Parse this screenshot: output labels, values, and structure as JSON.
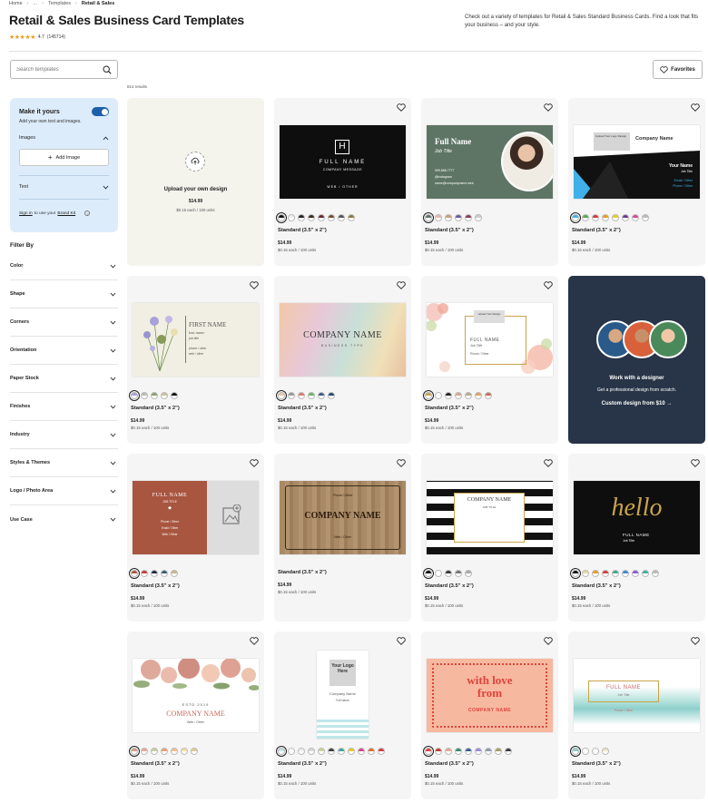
{
  "breadcrumb": [
    "Home",
    "...",
    "Templates",
    "Retail & Sales"
  ],
  "title": "Retail & Sales Business Card Templates",
  "rating": {
    "stars": "★★★★★",
    "value": "4.7",
    "count": "(145714)"
  },
  "description": "Check out a variety of templates for Retail & Sales Standard Business Cards. Find a look that fits your business – and your style.",
  "search": {
    "placeholder": "Search templates"
  },
  "favorites_label": "Favorites",
  "results_count": "814 results",
  "make_it_yours": {
    "title": "Make it yours",
    "subtitle": "Add your own text and images.",
    "images_label": "Images",
    "add_image": "Add Image",
    "text_label": "Text",
    "sign_in": "Sign in",
    "sign_mid": "to use your",
    "brand_kit": "Brand Kit"
  },
  "filter_by": "Filter By",
  "filters": [
    "Color",
    "Shape",
    "Corners",
    "Orientation",
    "Paper Stock",
    "Finishes",
    "Industry",
    "Styles & Themes",
    "Logo / Photo Area",
    "Use Case"
  ],
  "upload": {
    "title": "Upload your own design",
    "price": "$14.99",
    "units": "$0.15 each / 100 units"
  },
  "designer": {
    "title": "Work with a designer",
    "sub": "Get a professional design from scratch.",
    "link": "Custom design from $10 →"
  },
  "product": {
    "name": "Standard (3.5\" x 2\")",
    "price": "$14.99",
    "units": "$0.15 each / 100 units"
  },
  "cards": {
    "c1": {
      "name": "FULL NAME",
      "msg": "COMPANY MESSAGE",
      "web": "WEB / OTHER"
    },
    "c2": {
      "name": "Full Name",
      "job": "Job Title",
      "p1": "999.888.7777",
      "p2": "@instagram",
      "p3": "name@companyname.web"
    },
    "c3": {
      "logo": "Upload Your Logo Design",
      "company": "Company Name",
      "name": "Your Name",
      "job": "Job Title",
      "email": "Email / Other",
      "phone": "Phone / Other"
    },
    "c4": {
      "name": "FIRST NAME",
      "last": "last name",
      "job": "job title",
      "phone": "phone / other",
      "web": "web / other"
    },
    "c5": {
      "company": "COMPANY NAME",
      "type": "BUSINESS TYPE"
    },
    "c6": {
      "logo": "Upload Your Design",
      "name": "FULL NAME",
      "job": "Job Title",
      "phone": "Phone / Other"
    },
    "c7": {
      "name": "FULL NAME",
      "job": "JOB TITLE",
      "phone": "Phone / Other",
      "email": "Email / Other",
      "web": "Web / Other"
    },
    "c8": {
      "top": "Phone / Other",
      "company": "COMPANY NAME",
      "web": "Web / Other"
    },
    "c9": {
      "company": "COMPANY NAME",
      "job": "JOB TITLE"
    },
    "c10": {
      "script": "hello",
      "name": "FULL NAME",
      "job": "Job Title"
    },
    "c11": {
      "estd": "ESTD 2019",
      "company": "COMPANY NAME",
      "web": "Web / Other"
    },
    "c12": {
      "logo": "Your Logo Here",
      "company": "Company Name",
      "name": "Full Name"
    },
    "c13": {
      "line1": "with love",
      "line2": "from",
      "company": "COMPANY NAME"
    },
    "c14": {
      "name": "FULL NAME",
      "job": "Job Title",
      "phone": "Phone / Other"
    }
  },
  "colors": {
    "accent": "#1f5fa8",
    "designer_bg": "#283447",
    "star": "#e8a01c"
  }
}
